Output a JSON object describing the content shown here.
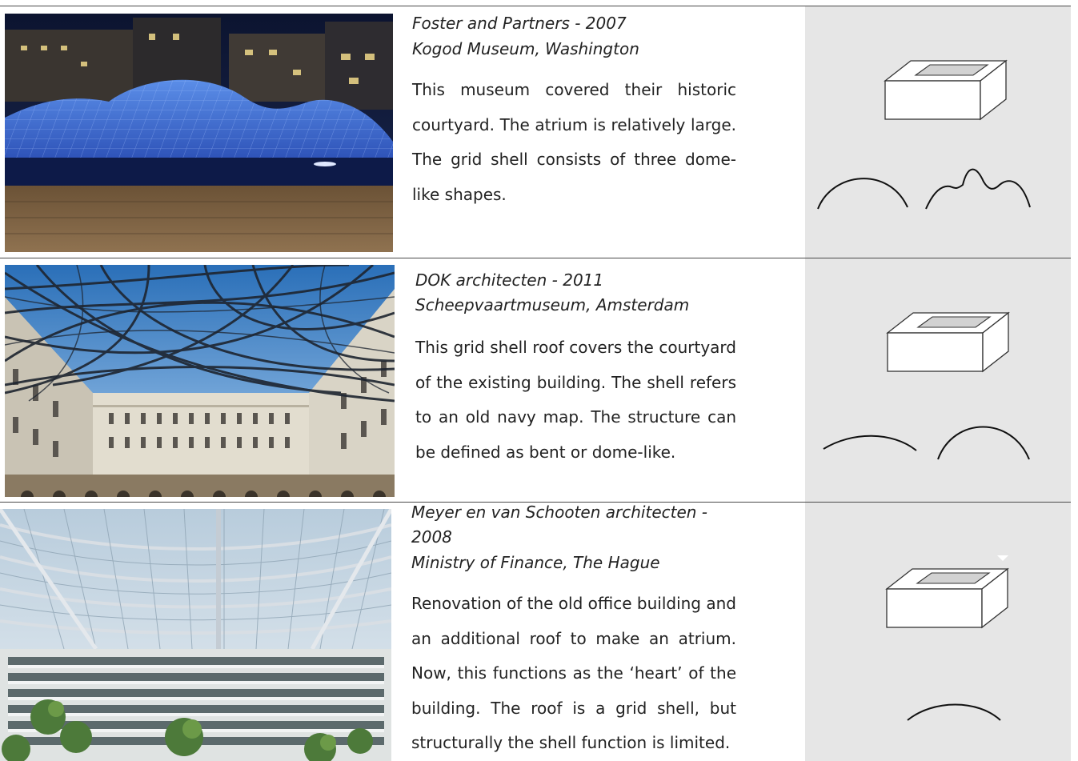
{
  "entries": [
    {
      "title_line1": "Foster and Partners - 2007",
      "title_line2": "Kogod Museum, Washington",
      "description": "This museum covered their historic courtyard. The atrium is relatively large. The grid shell consists of three dome-like shapes.",
      "photo": "night view of blue illuminated glass grid shell roof over a museum courtyard",
      "diagram_icons": [
        "courtyard-box-icon",
        "single-arch-icon",
        "triple-dome-icon"
      ]
    },
    {
      "title_line1": "DOK architecten - 2011",
      "title_line2": "Scheepvaartmuseum, Amsterdam",
      "description": "This grid shell roof covers the courtyard of the existing building. The shell refers to an old navy map. The structure can be defined as bent or dome-like.",
      "photo": "interior courtyard under a curving steel grid shell with blue sky",
      "diagram_icons": [
        "courtyard-box-icon",
        "shallow-arc-icon",
        "dome-arc-icon"
      ]
    },
    {
      "title_line1": "Meyer en van Schooten architecten -",
      "title_line2": "2008",
      "title_line3": "Ministry of Finance, The Hague",
      "description": "Renovation of the old office building and an additional roof to make an atrium. Now, this functions as the ‘heart’ of the building. The roof is a grid shell, but structurally the shell function is limited.",
      "photo": "bright atrium with a glass grid roof over office floors",
      "diagram_icons": [
        "courtyard-box-icon",
        "shallow-arc-icon"
      ]
    }
  ],
  "colors": {
    "panel": "#e6e6e6",
    "rule": "#4a4a4a",
    "text": "#222222"
  }
}
